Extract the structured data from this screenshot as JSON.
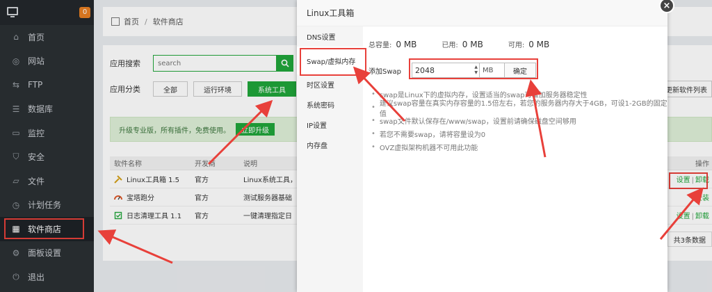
{
  "sidebar": {
    "badge": "0",
    "items": [
      {
        "label": "首页",
        "icon": "home-icon"
      },
      {
        "label": "网站",
        "icon": "globe-icon"
      },
      {
        "label": "FTP",
        "icon": "ftp-icon"
      },
      {
        "label": "数据库",
        "icon": "database-icon"
      },
      {
        "label": "监控",
        "icon": "monitor-icon"
      },
      {
        "label": "安全",
        "icon": "shield-icon"
      },
      {
        "label": "文件",
        "icon": "folder-icon"
      },
      {
        "label": "计划任务",
        "icon": "clock-icon"
      },
      {
        "label": "软件商店",
        "icon": "grid-icon"
      },
      {
        "label": "面板设置",
        "icon": "gear-icon"
      },
      {
        "label": "退出",
        "icon": "logout-icon"
      }
    ],
    "active_index": 8
  },
  "breadcrumb": {
    "home": "首页",
    "sep": "/",
    "current": "软件商店"
  },
  "search": {
    "label": "应用搜索",
    "placeholder": "search"
  },
  "category": {
    "label": "应用分类",
    "buttons": [
      "全部",
      "运行环境",
      "系统工具"
    ],
    "selected_index": 2,
    "refresh_label": "更新软件列表"
  },
  "promo": {
    "text": "升级专业版，所有插件，免费使用。",
    "button": "立即升级"
  },
  "table": {
    "headers": [
      "软件名称",
      "开发商",
      "说明",
      "操作"
    ],
    "rows": [
      {
        "name": "Linux工具箱 1.5",
        "dev": "官方",
        "desc": "Linux系统工具，",
        "op1": "设置",
        "op2": "卸载"
      },
      {
        "name": "宝塔跑分",
        "dev": "官方",
        "desc": "测试服务器基础",
        "op1": "安装",
        "op2": ""
      },
      {
        "name": "日志清理工具 1.1",
        "dev": "官方",
        "desc": "一键清理指定日",
        "op1": "设置",
        "op2": "卸载"
      }
    ],
    "op_sep": "|",
    "pager": "共3条数据"
  },
  "modal": {
    "title": "Linux工具箱",
    "close": "×",
    "nav": [
      "DNS设置",
      "Swap/虚拟内存",
      "时区设置",
      "系统密码",
      "IP设置",
      "内存盘"
    ],
    "active_nav": 1,
    "stats": [
      {
        "k": "总容量:",
        "v": "0 MB"
      },
      {
        "k": "已用:",
        "v": "0 MB"
      },
      {
        "k": "可用:",
        "v": "0 MB"
      }
    ],
    "swap_label": "添加Swap",
    "swap_value": "2048",
    "swap_unit": "MB",
    "swap_ok": "确定",
    "tips": [
      "swap是Linux下的虚拟内存，设置适当的swap可增加服务器稳定性",
      "建议swap容量在真实内存容量的1.5倍左右，若您的服务器内存大于4GB，可设1-2GB的固定值",
      "swap文件默认保存在/www/swap，设置前请确保磁盘空间够用",
      "若您不需要swap，请将容量设为0",
      "OVZ虚拟架构机器不可用此功能"
    ]
  },
  "colors": {
    "accent": "#20a53a",
    "sidebar_bg": "#2b3034",
    "highlight": "#e8403a",
    "badge": "#e67e22"
  }
}
